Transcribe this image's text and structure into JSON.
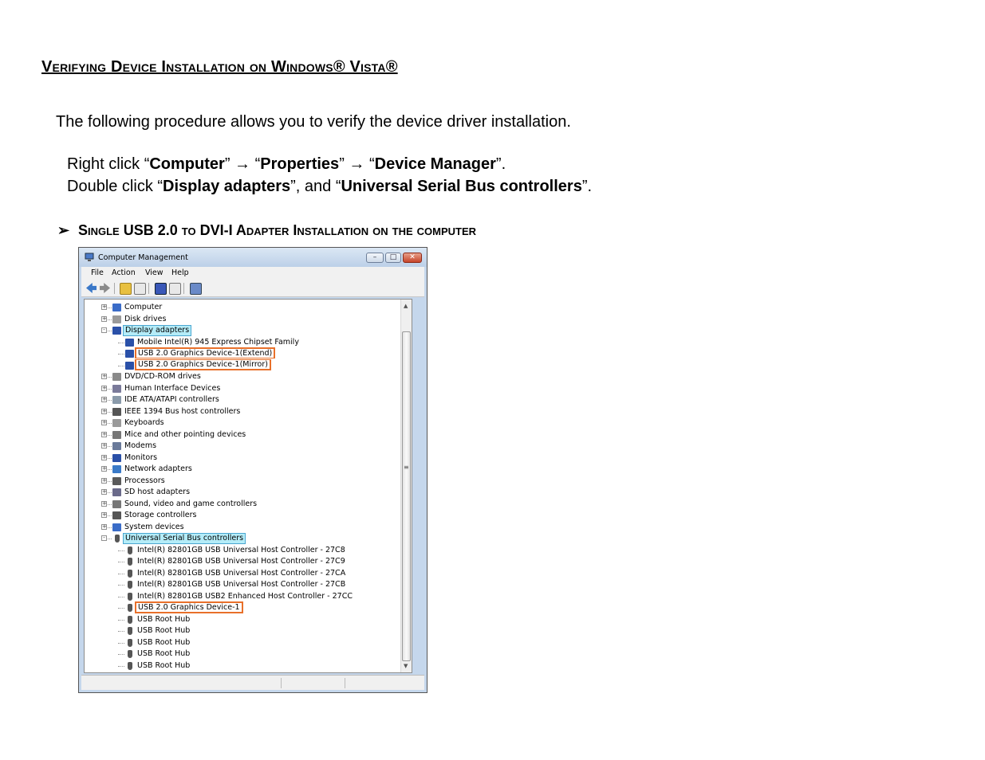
{
  "doc": {
    "title": "Verifying Device Installation on Windows® Vista®",
    "intro": "The following procedure allows you to verify the device driver installation.",
    "step1": {
      "p1": "Right click “",
      "b1": "Computer",
      "p2": "” → “",
      "b2": "Properties",
      "p3": "” → “",
      "b3": "Device Manager",
      "p4": "”."
    },
    "step2": {
      "p1": "Double click “",
      "b1": "Display adapters",
      "p2": "”, and “",
      "b2": "Universal Serial Bus controllers",
      "p3": "”."
    },
    "section_bullet": "➢",
    "section_title": "Single USB 2.0 to DVI-I Adapter Installation on the computer"
  },
  "window": {
    "title": "Computer Management",
    "minimize": "–",
    "maximize": "□",
    "close": "✕",
    "menu": [
      "File",
      "Action",
      "View",
      "Help"
    ],
    "tree": [
      {
        "label": "Computer",
        "level": 1,
        "expander": "+",
        "icon": "computer-icon",
        "color": "#3a6cc8"
      },
      {
        "label": "Disk drives",
        "level": 1,
        "expander": "+",
        "icon": "disk-drive-icon",
        "color": "#9a9a9a"
      },
      {
        "label": "Display adapters",
        "level": 1,
        "expander": "-",
        "icon": "display-adapter-icon",
        "color": "#2a50a8",
        "state": "selected"
      },
      {
        "label": "Mobile Intel(R) 945 Express Chipset Family",
        "level": 2,
        "icon": "display-adapter-icon",
        "color": "#2a50a8"
      },
      {
        "label": "USB 2.0 Graphics Device-1(Extend)",
        "level": 2,
        "icon": "display-adapter-icon",
        "color": "#2a50a8",
        "state": "highlight-top"
      },
      {
        "label": "USB 2.0 Graphics Device-1(Mirror)",
        "level": 2,
        "icon": "display-adapter-icon",
        "color": "#2a50a8",
        "state": "highlight-bottom"
      },
      {
        "label": "DVD/CD-ROM drives",
        "level": 1,
        "expander": "+",
        "icon": "dvd-drive-icon",
        "color": "#8a8a8a"
      },
      {
        "label": "Human Interface Devices",
        "level": 1,
        "expander": "+",
        "icon": "hid-icon",
        "color": "#7a7a9a"
      },
      {
        "label": "IDE ATA/ATAPI controllers",
        "level": 1,
        "expander": "+",
        "icon": "ide-controller-icon",
        "color": "#8a9aaa"
      },
      {
        "label": "IEEE 1394 Bus host controllers",
        "level": 1,
        "expander": "+",
        "icon": "ieee1394-icon",
        "color": "#555555"
      },
      {
        "label": "Keyboards",
        "level": 1,
        "expander": "+",
        "icon": "keyboard-icon",
        "color": "#9a9a9a"
      },
      {
        "label": "Mice and other pointing devices",
        "level": 1,
        "expander": "+",
        "icon": "mouse-icon",
        "color": "#777777"
      },
      {
        "label": "Modems",
        "level": 1,
        "expander": "+",
        "icon": "modem-icon",
        "color": "#6a7a9a"
      },
      {
        "label": "Monitors",
        "level": 1,
        "expander": "+",
        "icon": "monitor-icon",
        "color": "#2a50a8"
      },
      {
        "label": "Network adapters",
        "level": 1,
        "expander": "+",
        "icon": "network-adapter-icon",
        "color": "#3a7ac8"
      },
      {
        "label": "Processors",
        "level": 1,
        "expander": "+",
        "icon": "processor-icon",
        "color": "#5a5a5a"
      },
      {
        "label": "SD host adapters",
        "level": 1,
        "expander": "+",
        "icon": "sd-host-icon",
        "color": "#6a6a8a"
      },
      {
        "label": "Sound, video and game controllers",
        "level": 1,
        "expander": "+",
        "icon": "speaker-icon",
        "color": "#777777"
      },
      {
        "label": "Storage controllers",
        "level": 1,
        "expander": "+",
        "icon": "storage-controller-icon",
        "color": "#555555"
      },
      {
        "label": "System devices",
        "level": 1,
        "expander": "+",
        "icon": "system-device-icon",
        "color": "#3a6cc8"
      },
      {
        "label": "Universal Serial Bus controllers",
        "level": 1,
        "expander": "-",
        "icon": "usb-icon",
        "color": "#555555",
        "state": "selected"
      },
      {
        "label": "Intel(R) 82801GB USB Universal Host Controller - 27C8",
        "level": 2,
        "icon": "usb-icon",
        "color": "#555555"
      },
      {
        "label": "Intel(R) 82801GB USB Universal Host Controller - 27C9",
        "level": 2,
        "icon": "usb-icon",
        "color": "#555555"
      },
      {
        "label": "Intel(R) 82801GB USB Universal Host Controller - 27CA",
        "level": 2,
        "icon": "usb-icon",
        "color": "#555555"
      },
      {
        "label": "Intel(R) 82801GB USB Universal Host Controller - 27CB",
        "level": 2,
        "icon": "usb-icon",
        "color": "#555555"
      },
      {
        "label": "Intel(R) 82801GB USB2 Enhanced Host Controller - 27CC",
        "level": 2,
        "icon": "usb-icon",
        "color": "#555555"
      },
      {
        "label": "USB 2.0 Graphics Device-1",
        "level": 2,
        "icon": "usb-icon",
        "color": "#555555",
        "state": "highlight"
      },
      {
        "label": "USB Root Hub",
        "level": 2,
        "icon": "usb-icon",
        "color": "#555555"
      },
      {
        "label": "USB Root Hub",
        "level": 2,
        "icon": "usb-icon",
        "color": "#555555"
      },
      {
        "label": "USB Root Hub",
        "level": 2,
        "icon": "usb-icon",
        "color": "#555555"
      },
      {
        "label": "USB Root Hub",
        "level": 2,
        "icon": "usb-icon",
        "color": "#555555"
      },
      {
        "label": "USB Root Hub",
        "level": 2,
        "icon": "usb-icon",
        "color": "#555555"
      }
    ]
  },
  "colors": {
    "selection": "#b4ecf8",
    "highlight_border": "#e8702a"
  }
}
